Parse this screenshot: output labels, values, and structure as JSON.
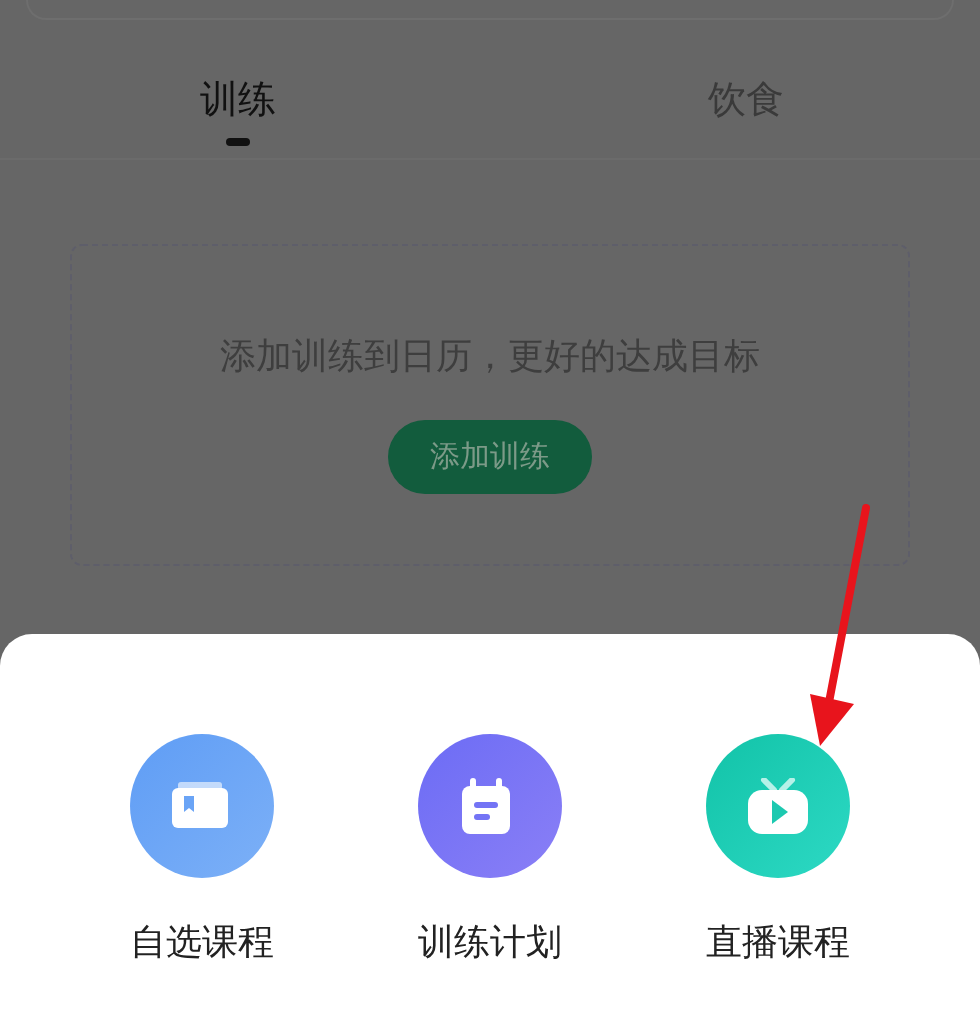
{
  "tabs": [
    {
      "label": "训练",
      "selected": true
    },
    {
      "label": "饮食",
      "selected": false
    }
  ],
  "empty_state": {
    "message": "添加训练到日历，更好的达成目标",
    "button": "添加训练"
  },
  "sheet": {
    "options": [
      {
        "kind": "course",
        "label": "自选课程"
      },
      {
        "kind": "plan",
        "label": "训练计划"
      },
      {
        "kind": "live",
        "label": "直播课程"
      }
    ]
  }
}
